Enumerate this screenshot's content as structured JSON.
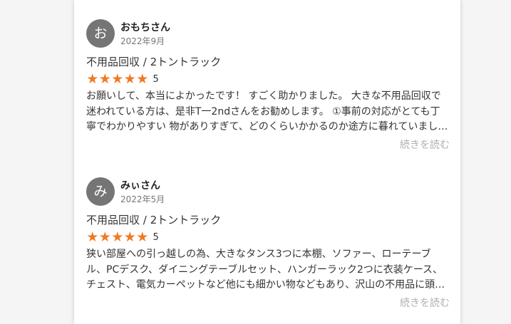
{
  "reviews": [
    {
      "avatar_initial": "お",
      "name": "おもちさん",
      "date": "2022年9月",
      "service": "不用品回収 / 2トントラック",
      "stars": [
        "★",
        "★",
        "★",
        "★",
        "★"
      ],
      "rating": "5",
      "text": "お願いして、本当によかったです！ すごく助かりました。 大きな不用品回収で迷われている方は、是非T一2ndさんをお勧めします。 ①事前の対応がとても丁寧でわかりやすい 物がありすぎて、どのくらいかかるのか途方に暮れていました。",
      "read_more": "続きを読む"
    },
    {
      "avatar_initial": "み",
      "name": "みぃさん",
      "date": "2022年5月",
      "service": "不用品回収 / 2トントラック",
      "stars": [
        "★",
        "★",
        "★",
        "★",
        "★"
      ],
      "rating": "5",
      "text": "狭い部屋への引っ越しの為、大きなタンス3つに本棚、ソファー、ローテーブル、PCデスク、ダイニングテーブルセット、ハンガーラック2つに衣装ケース、チェスト、電気カーペットなど他にも細かい物などもあり、沢山の不用品に頭を悩ませていました。",
      "read_more": "続きを読む"
    }
  ],
  "colors": {
    "star": "#f07a22",
    "avatar_bg": "#757575",
    "read_more": "#b0b0b0"
  },
  "icons": {
    "star": "star-icon"
  }
}
